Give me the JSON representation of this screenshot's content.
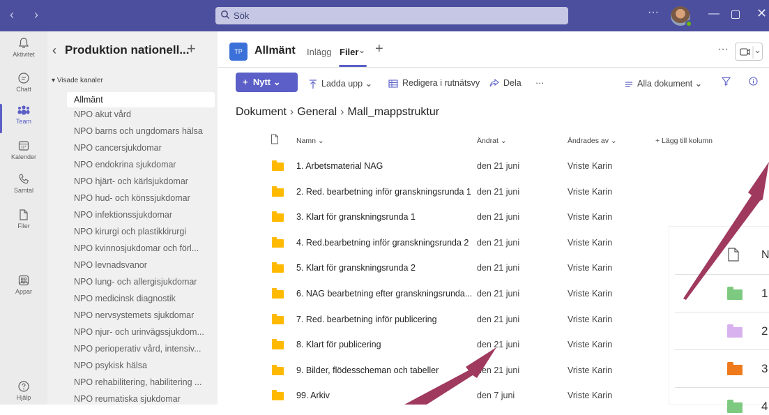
{
  "titlebar": {
    "search_placeholder": "Sök",
    "more": "···"
  },
  "rail": {
    "items": [
      {
        "label": "Aktivitet"
      },
      {
        "label": "Chatt"
      },
      {
        "label": "Team"
      },
      {
        "label": "Kalender"
      },
      {
        "label": "Samtal"
      },
      {
        "label": "Filer"
      },
      {
        "label": "Appar"
      },
      {
        "label": "Hjälp"
      }
    ],
    "more": "···"
  },
  "channels": {
    "title": "Produktion nationell...",
    "section": "Visade kanaler",
    "selected": "Allmänt",
    "items": [
      "NPO akut vård",
      "NPO barns och ungdomars hälsa",
      "NPO cancersjukdomar",
      "NPO endokrina sjukdomar",
      "NPO hjärt- och kärlsjukdomar",
      "NPO hud- och könssjukdomar",
      "NPO infektionssjukdomar",
      "NPO kirurgi och plastikkirurgi",
      "NPO kvinnosjukdomar och förl...",
      "NPO levnadsvanor",
      "NPO lung- och allergisjukdomar",
      "NPO medicinsk diagnostik",
      "NPO nervsystemets sjukdomar",
      "NPO njur- och urinvägssjukdom...",
      "NPO perioperativ vård, intensiv...",
      "NPO psykisk hälsa",
      "NPO rehabilitering, habilitering ...",
      "NPO reumatiska sjukdomar"
    ]
  },
  "channel_header": {
    "team_initials": "TP",
    "name": "Allmänt",
    "tab_posts": "Inlägg",
    "tab_files": "Filer",
    "more": "···"
  },
  "toolbar": {
    "new": "Nytt",
    "upload": "Ladda upp",
    "grid_edit": "Redigera i rutnätsvy",
    "share": "Dela",
    "more": "···",
    "view": "Alla dokument"
  },
  "breadcrumb": [
    "Dokument",
    "General",
    "Mall_mappstruktur"
  ],
  "columns": {
    "name": "Namn",
    "modified": "Ändrat",
    "modified_by": "Ändrades av",
    "add_column": "+ Lägg till kolumn"
  },
  "rows": [
    {
      "name": "1. Arbetsmaterial NAG",
      "modified": "den 21 juni",
      "by": "Vriste Karin"
    },
    {
      "name": "2. Red. bearbetning inför granskningsrunda 1",
      "modified": "den 21 juni",
      "by": "Vriste Karin"
    },
    {
      "name": "3. Klart för granskningsrunda 1",
      "modified": "den 21 juni",
      "by": "Vriste Karin"
    },
    {
      "name": "4. Red.bearbetning inför granskningsrunda 2",
      "modified": "den 21 juni",
      "by": "Vriste Karin"
    },
    {
      "name": "5. Klart för granskningsrunda 2",
      "modified": "den 21 juni",
      "by": "Vriste Karin"
    },
    {
      "name": "6. NAG bearbetning efter granskningsrunda...",
      "modified": "den 21 juni",
      "by": "Vriste Karin"
    },
    {
      "name": "7. Red. bearbetning inför publicering",
      "modified": "den 21 juni",
      "by": "Vriste Karin"
    },
    {
      "name": "8. Klart för publicering",
      "modified": "den 21 juni",
      "by": "Vriste Karin"
    },
    {
      "name": "9. Bilder, flödesscheman och tabeller",
      "modified": "den 21 juni",
      "by": "Vriste Karin"
    },
    {
      "name": "99. Arkiv",
      "modified": "den 7 juni",
      "by": "Vriste Karin"
    }
  ],
  "zoom_callout": {
    "header_fragment": "N",
    "rows": [
      {
        "num": "1",
        "color": "#7dc97f"
      },
      {
        "num": "2",
        "color": "#d7b2ef"
      },
      {
        "num": "3",
        "color": "#ee7a1b"
      },
      {
        "num": "4",
        "color": "#7dc97f"
      }
    ]
  },
  "colors": {
    "titlebar": "#4b4f9e",
    "accent": "#5b5fc7",
    "folder": "#ffb900",
    "arrow": "#a0395e"
  }
}
